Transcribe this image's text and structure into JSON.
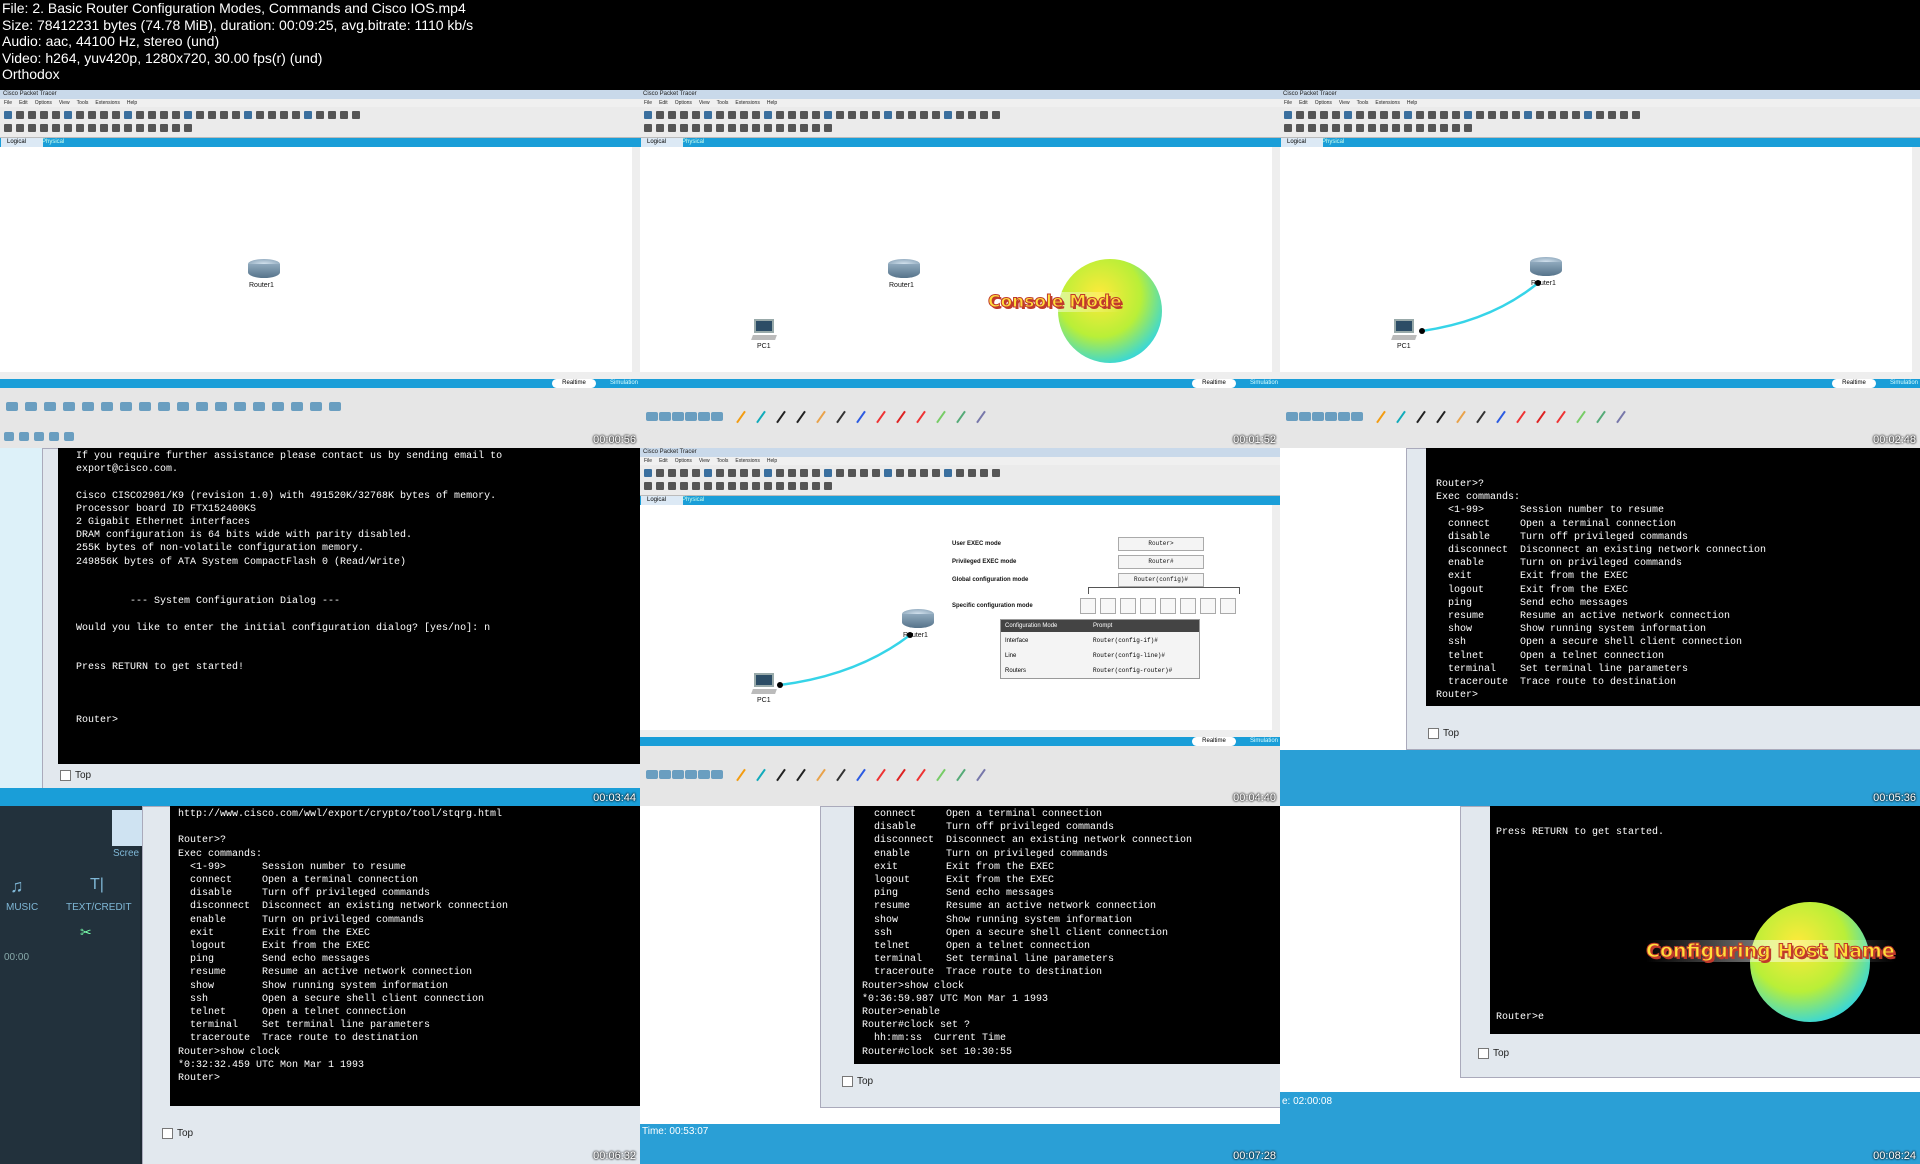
{
  "header": {
    "lines": [
      "File: 2. Basic Router Configuration Modes, Commands and Cisco IOS.mp4",
      "Size: 78412231 bytes (74.78 MiB), duration: 00:09:25, avg.bitrate: 1110 kb/s",
      "Audio: aac, 44100 Hz, stereo (und)",
      "Video: h264, yuv420p, 1280x720, 30.00 fps(r) (und)",
      "Orthodox"
    ]
  },
  "pt": {
    "window_title": "Cisco Packet Tracer",
    "menu": [
      "File",
      "Edit",
      "Options",
      "View",
      "Tools",
      "Extensions",
      "Help"
    ],
    "logical_tab": "Logical",
    "physical_tab": "Physical",
    "realtime": "Realtime",
    "simulation": "Simulation",
    "router_label": "Router1",
    "pc_label": "PC1"
  },
  "tiles": [
    {
      "timestamp": "00:00:56"
    },
    {
      "timestamp": "00:01:52",
      "badge": "Console Mode"
    },
    {
      "timestamp": "00:02:48"
    },
    {
      "timestamp": "00:03:44",
      "check_label": "Top",
      "lines": [
        "If you require further assistance please contact us by sending email to",
        "export@cisco.com.",
        "",
        "Cisco CISCO2901/K9 (revision 1.0) with 491520K/32768K bytes of memory.",
        "Processor board ID FTX152400KS",
        "2 Gigabit Ethernet interfaces",
        "DRAM configuration is 64 bits wide with parity disabled.",
        "255K bytes of non-volatile configuration memory.",
        "249856K bytes of ATA System CompactFlash 0 (Read/Write)",
        "",
        "",
        "         --- System Configuration Dialog ---",
        "",
        "Would you like to enter the initial configuration dialog? [yes/no]: n",
        "",
        "",
        "Press RETURN to get started!",
        "",
        "",
        "",
        "Router>"
      ]
    },
    {
      "timestamp": "00:04:40",
      "modes": {
        "user": "User EXEC mode",
        "priv": "Privileged EXEC mode",
        "global": "Global configuration mode",
        "specific": "Specific configuration mode",
        "p_user": "Router>",
        "p_priv": "Router#",
        "p_global": "Router(config)#"
      },
      "table": {
        "h1": "Configuration Mode",
        "h2": "Prompt",
        "rows": [
          [
            "Interface",
            "Router(config-if)#"
          ],
          [
            "Line",
            "Router(config-line)#"
          ],
          [
            "Routers",
            "Router(config-router)#"
          ]
        ]
      }
    },
    {
      "timestamp": "00:05:36",
      "check_label": "Top",
      "lines": [
        "Router>?",
        "Exec commands:",
        "  <1-99>      Session number to resume",
        "  connect     Open a terminal connection",
        "  disable     Turn off privileged commands",
        "  disconnect  Disconnect an existing network connection",
        "  enable      Turn on privileged commands",
        "  exit        Exit from the EXEC",
        "  logout      Exit from the EXEC",
        "  ping        Send echo messages",
        "  resume      Resume an active network connection",
        "  show        Show running system information",
        "  ssh         Open a secure shell client connection",
        "  telnet      Open a telnet connection",
        "  terminal    Set terminal line parameters",
        "  traceroute  Trace route to destination",
        "Router>"
      ]
    },
    {
      "timestamp": "00:06:32",
      "check_label": "Top",
      "side": {
        "music": "MUSIC",
        "text": "TEXT/CREDIT",
        "time": "00:00",
        "scr": "Scree"
      },
      "lines": [
        "http://www.cisco.com/wwl/export/crypto/tool/stqrg.html",
        "",
        "Router>?",
        "Exec commands:",
        "  <1-99>      Session number to resume",
        "  connect     Open a terminal connection",
        "  disable     Turn off privileged commands",
        "  disconnect  Disconnect an existing network connection",
        "  enable      Turn on privileged commands",
        "  exit        Exit from the EXEC",
        "  logout      Exit from the EXEC",
        "  ping        Send echo messages",
        "  resume      Resume an active network connection",
        "  show        Show running system information",
        "  ssh         Open a secure shell client connection",
        "  telnet      Open a telnet connection",
        "  terminal    Set terminal line parameters",
        "  traceroute  Trace route to destination",
        "Router>show clock",
        "*0:32:32.459 UTC Mon Mar 1 1993",
        "Router>"
      ]
    },
    {
      "timestamp": "00:07:28",
      "check_label": "Top",
      "time_label": "Time: 00:53:07",
      "lines": [
        "  connect     Open a terminal connection",
        "  disable     Turn off privileged commands",
        "  disconnect  Disconnect an existing network connection",
        "  enable      Turn on privileged commands",
        "  exit        Exit from the EXEC",
        "  logout      Exit from the EXEC",
        "  ping        Send echo messages",
        "  resume      Resume an active network connection",
        "  show        Show running system information",
        "  ssh         Open a secure shell client connection",
        "  telnet      Open a telnet connection",
        "  terminal    Set terminal line parameters",
        "  traceroute  Trace route to destination",
        "Router>show clock",
        "*0:36:59.987 UTC Mon Mar 1 1993",
        "Router>enable",
        "Router#clock set ?",
        "  hh:mm:ss  Current Time",
        "Router#clock set 10:30:55"
      ]
    },
    {
      "timestamp": "00:08:24",
      "check_label": "Top",
      "time_label": "e: 02:00:08",
      "badge": "Configuring Host Name",
      "lines": [
        "Press RETURN to get started.",
        "",
        "",
        "",
        "",
        "",
        "",
        "",
        "",
        "",
        "",
        "",
        "",
        "",
        "Router>e"
      ]
    }
  ]
}
